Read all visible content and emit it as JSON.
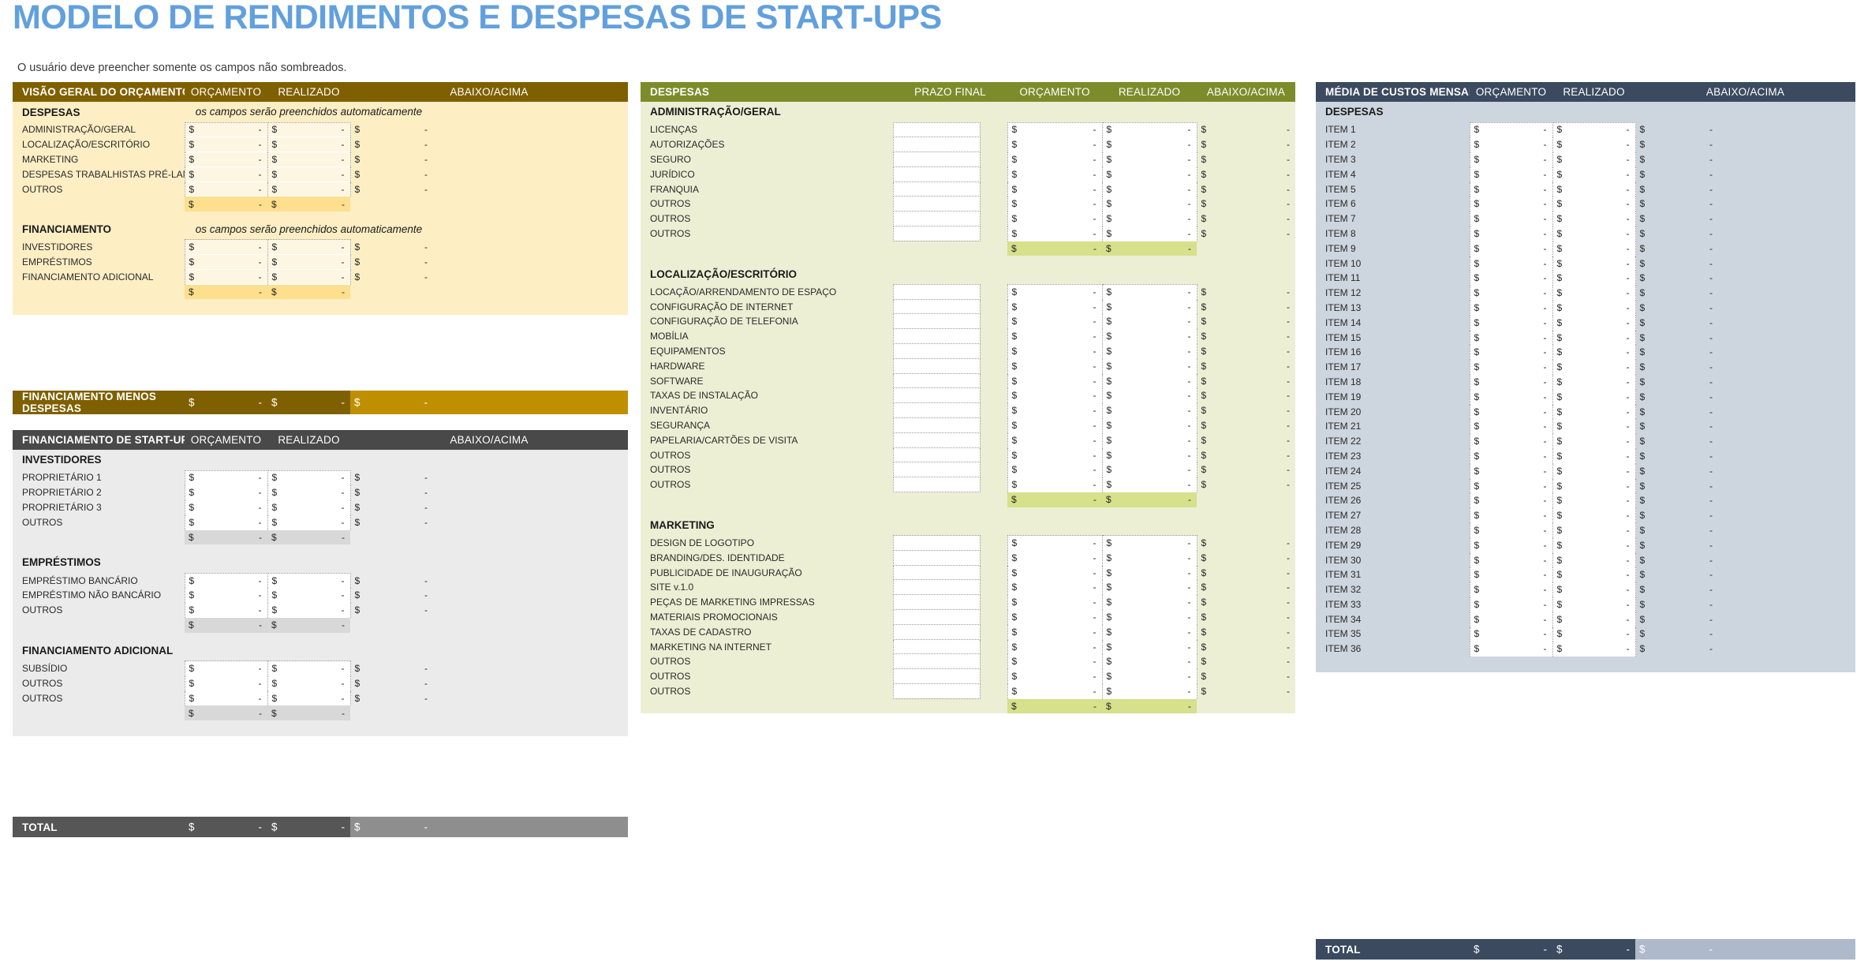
{
  "page": {
    "title": "MODELO DE RENDIMENTOS E DESPESAS DE START-UPS",
    "subtitle": "O usuário deve preencher somente os campos não sombreados.",
    "auto_note": "os campos serão preenchidos automaticamente",
    "currency_symbol": "$",
    "dash": "-",
    "colors": {
      "title": "#62a0dd",
      "gold_header": "#7f6000",
      "gold_accent": "#bf8f00",
      "gold_body": "#fdeec4",
      "gold_subtotal": "#fddf8e",
      "grey_header": "#494949",
      "grey_total": "#565656",
      "grey_accent": "#8e8e8e",
      "grey_body": "#ebebeb",
      "grey_subtotal": "#d8d8d8",
      "green_header": "#7d8c2b",
      "green_body": "#ecefd4",
      "green_subtotal": "#d7e08a",
      "blue_header": "#3b4a5f",
      "blue_body": "#cdd5de",
      "blue_accent": "#aebacb"
    }
  },
  "overview": {
    "header": {
      "title": "VISÃO GERAL DO ORÇAMENTO DE START-U",
      "c1": "ORÇAMENTO",
      "c2": "REALIZADO",
      "c3": "ABAIXO/ACIMA"
    },
    "expenses_label": "DESPESAS",
    "expenses": [
      "ADMINISTRAÇÃO/GERAL",
      "LOCALIZAÇÃO/ESCRITÓRIO",
      "MARKETING",
      "DESPESAS TRABALHISTAS PRÉ-LANÇAMENTO",
      "OUTROS"
    ],
    "financing_label": "FINANCIAMENTO",
    "financing": [
      "INVESTIDORES",
      "EMPRÉSTIMOS",
      "FINANCIAMENTO ADICIONAL"
    ],
    "bottom_label": "FINANCIAMENTO MENOS DESPESAS"
  },
  "funding": {
    "header": {
      "title": "FINANCIAMENTO DE START-UP",
      "c1": "ORÇAMENTO",
      "c2": "REALIZADO",
      "c3": "ABAIXO/ACIMA"
    },
    "groups": [
      {
        "label": "INVESTIDORES",
        "items": [
          "PROPRIETÁRIO 1",
          "PROPRIETÁRIO 2",
          "PROPRIETÁRIO 3",
          "OUTROS"
        ]
      },
      {
        "label": "EMPRÉSTIMOS",
        "items": [
          "EMPRÉSTIMO BANCÁRIO",
          "EMPRÉSTIMO NÃO BANCÁRIO",
          "OUTROS"
        ]
      },
      {
        "label": "FINANCIAMENTO ADICIONAL",
        "items": [
          "SUBSÍDIO",
          "OUTROS",
          "OUTROS"
        ]
      }
    ],
    "total_label": "TOTAL"
  },
  "expenses": {
    "header": {
      "title": "DESPESAS",
      "c0": "PRAZO FINAL",
      "c1": "ORÇAMENTO",
      "c2": "REALIZADO",
      "c3": "ABAIXO/ACIMA"
    },
    "groups": [
      {
        "label": "ADMINISTRAÇÃO/GERAL",
        "items": [
          "LICENÇAS",
          "AUTORIZAÇÕES",
          "SEGURO",
          "JURÍDICO",
          "FRANQUIA",
          "OUTROS",
          "OUTROS",
          "OUTROS"
        ]
      },
      {
        "label": "LOCALIZAÇÃO/ESCRITÓRIO",
        "items": [
          "LOCAÇÃO/ARRENDAMENTO DE ESPAÇO",
          "CONFIGURAÇÃO DE INTERNET",
          "CONFIGURAÇÃO DE TELEFONIA",
          "MOBÍLIA",
          "EQUIPAMENTOS",
          "HARDWARE",
          "SOFTWARE",
          "TAXAS DE INSTALAÇÃO",
          "INVENTÁRIO",
          "SEGURANÇA",
          "PAPELARIA/CARTÕES DE VISITA",
          "OUTROS",
          "OUTROS",
          "OUTROS"
        ]
      },
      {
        "label": "MARKETING",
        "items": [
          "DESIGN DE LOGOTIPO",
          "BRANDING/DES. IDENTIDADE",
          "PUBLICIDADE DE INAUGURAÇÃO",
          "SITE v.1.0",
          "PEÇAS DE MARKETING IMPRESSAS",
          "MATERIAIS PROMOCIONAIS",
          "TAXAS DE CADASTRO",
          "MARKETING NA INTERNET",
          "OUTROS",
          "OUTROS",
          "OUTROS"
        ]
      }
    ]
  },
  "monthly": {
    "header": {
      "title": "MÉDIA DE CUSTOS MENSAIS PROJETADO",
      "c1": "ORÇAMENTO",
      "c2": "REALIZADO",
      "c3": "ABAIXO/ACIMA"
    },
    "expenses_label": "DESPESAS",
    "items": [
      "ITEM 1",
      "ITEM 2",
      "ITEM 3",
      "ITEM 4",
      "ITEM 5",
      "ITEM 6",
      "ITEM 7",
      "ITEM 8",
      "ITEM 9",
      "ITEM 10",
      "ITEM 11",
      "ITEM 12",
      "ITEM 13",
      "ITEM 14",
      "ITEM 15",
      "ITEM 16",
      "ITEM 17",
      "ITEM 18",
      "ITEM 19",
      "ITEM 20",
      "ITEM 21",
      "ITEM 22",
      "ITEM 23",
      "ITEM 24",
      "ITEM 25",
      "ITEM 26",
      "ITEM 27",
      "ITEM 28",
      "ITEM 29",
      "ITEM 30",
      "ITEM 31",
      "ITEM 32",
      "ITEM 33",
      "ITEM 34",
      "ITEM 35",
      "ITEM 36"
    ],
    "total_label": "TOTAL"
  }
}
